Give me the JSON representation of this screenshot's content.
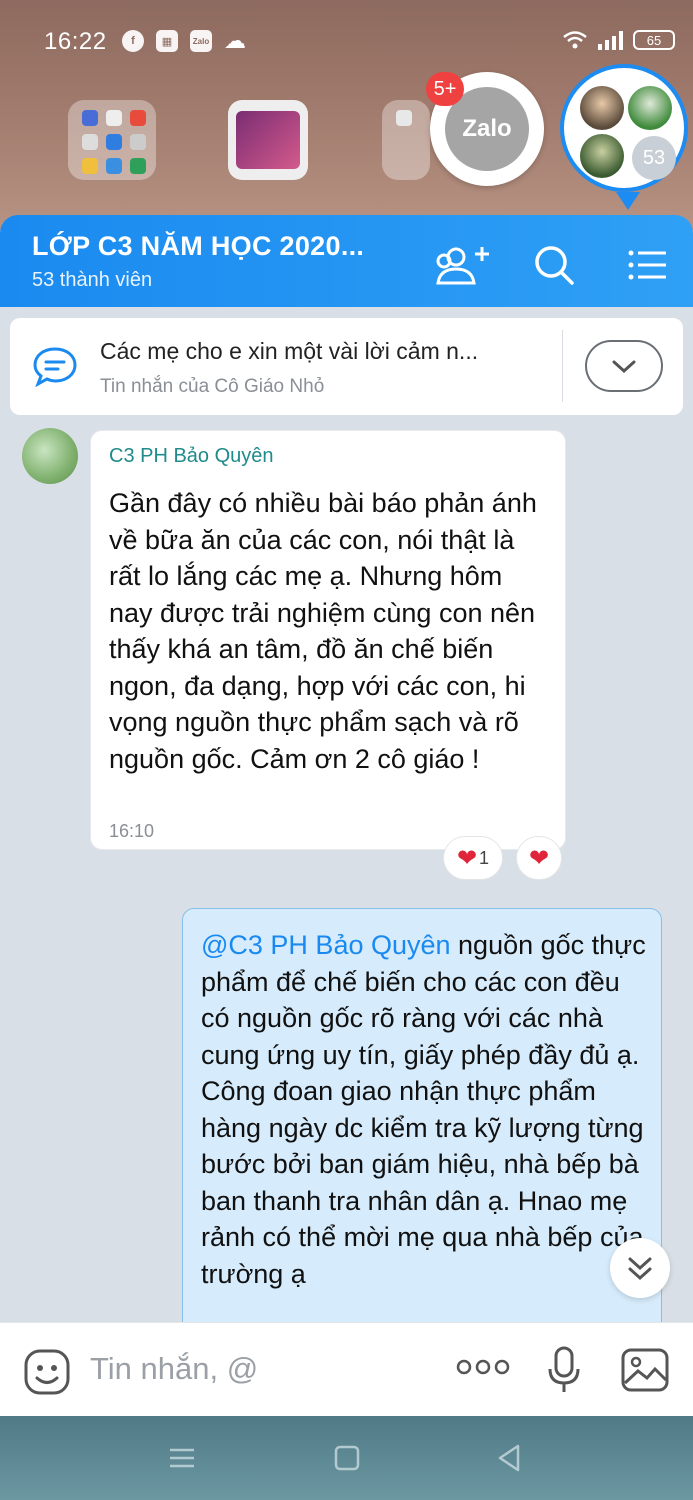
{
  "status_bar": {
    "time": "16:22",
    "app_icons": [
      "facebook-icon",
      "calculator-icon",
      "zalo-icon",
      "cloud-icon"
    ],
    "battery": "65"
  },
  "launcher": {
    "zalo_label": "Zalo",
    "zalo_badge": "5+",
    "group_member_count": "53"
  },
  "header": {
    "title": "LỚP C3 NĂM HỌC 2020...",
    "subtitle": "53 thành viên"
  },
  "pinned": {
    "text": "Các mẹ cho e xin một vài lời cảm n...",
    "sub": "Tin nhắn của Cô Giáo Nhỏ"
  },
  "message": {
    "sender": "C3 PH Bảo Quyên",
    "body": "Gần đây có nhiều bài báo phản ánh về bữa ăn của các con, nói thật là rất lo lắng các mẹ ạ. Nhưng hôm nay được trải nghiệm cùng con nên thấy khá an tâm, đồ ăn chế biến ngon, đa dạng, hợp với các con, hi vọng nguồn thực phẩm sạch và rõ nguồn gốc. Cảm ơn 2 cô giáo !",
    "time": "16:10",
    "reaction_count": "1"
  },
  "reply": {
    "mention": "@C3 PH Bảo Quyên",
    "body": " nguồn gốc thực phẩm để chế biến cho các con đều có nguồn gốc rõ ràng với các nhà cung ứng uy tín, giấy phép đầy đủ ạ. Công đoan giao nhận thực phẩm hàng ngày dc kiểm tra kỹ lượng từng bước bởi ban giám hiệu, nhà bếp bà ban thanh tra nhân dân ạ. Hnao mẹ rảnh có thể mời mẹ qua nhà bếp của trường ạ"
  },
  "input": {
    "placeholder": "Tin nhắn, @"
  },
  "colors": {
    "accent": "#1a8af0",
    "sender": "#1f8b8a",
    "reply_bg": "#d6ebfb",
    "heart": "#e0253b"
  }
}
